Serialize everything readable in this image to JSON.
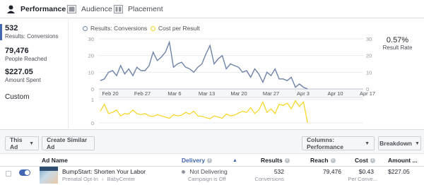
{
  "tabs": [
    {
      "label": "Performance",
      "icon": "person-icon",
      "active": true
    },
    {
      "label": "Audience",
      "icon": "audience-icon",
      "active": false
    },
    {
      "label": "Placement",
      "icon": "placement-icon",
      "active": false
    }
  ],
  "metrics": {
    "results": {
      "value": "532",
      "label": "Results: Conversions"
    },
    "reach": {
      "value": "79,476",
      "label": "People Reached"
    },
    "spent": {
      "value": "$227.05",
      "label": "Amount Spent"
    },
    "custom": "Custom"
  },
  "result_rate": {
    "value": "0.57%",
    "label": "Result Rate"
  },
  "colors": {
    "accent": "#4267b2",
    "conversions": "#6f83a9",
    "cost": "#f7d51d"
  },
  "chart_data": [
    {
      "type": "line",
      "legend": [
        "Results: Conversions",
        "Cost per Result"
      ],
      "x_ticks": [
        "Feb 20",
        "Feb 27",
        "Mar 6",
        "Mar 13",
        "Mar 20",
        "Mar 27",
        "Apr 3",
        "Apr 10",
        "Apr 17"
      ],
      "ylim": [
        0,
        30
      ],
      "y_ticks": [
        "0",
        "10",
        "20",
        "30"
      ],
      "grid": true,
      "series": [
        {
          "name": "Results: Conversions",
          "values": [
            5,
            6,
            10,
            11,
            8,
            14,
            9,
            12,
            8,
            13,
            11,
            11,
            14,
            22,
            17,
            19,
            22,
            28,
            13,
            15,
            16,
            13,
            12,
            10,
            13,
            15,
            21,
            26,
            15,
            18,
            20,
            12,
            15,
            14,
            13,
            10,
            11,
            7,
            12,
            9,
            4,
            10,
            8,
            12,
            6,
            6,
            5,
            7,
            1,
            3,
            1,
            0
          ]
        }
      ]
    },
    {
      "type": "line",
      "ylim": [
        0,
        1
      ],
      "y_ticks": [
        "0",
        "1"
      ],
      "series": [
        {
          "name": "Cost per Result",
          "values": [
            0.5,
            0.8,
            0.4,
            0.45,
            0.55,
            0.3,
            0.4,
            0.38,
            0.55,
            0.4,
            0.35,
            0.4,
            0.3,
            0.28,
            0.35,
            0.3,
            0.25,
            0.2,
            0.35,
            0.3,
            0.33,
            0.45,
            0.38,
            0.5,
            0.3,
            0.28,
            0.22,
            0.18,
            0.3,
            0.25,
            0.2,
            0.38,
            0.3,
            0.33,
            0.42,
            0.5,
            0.45,
            0.65,
            0.4,
            0.55,
            0.9,
            0.45,
            0.6,
            0.4,
            0.8,
            0.75,
            0.85,
            0.6,
            0.95,
            0.7,
            0.9,
            0
          ]
        }
      ]
    }
  ],
  "toolbar": {
    "this_ad": "This Ad",
    "create_similar": "Create Similar Ad",
    "columns": "Columns: Performance",
    "breakdown": "Breakdown"
  },
  "table": {
    "headers": {
      "ad_name": "Ad Name",
      "delivery": "Delivery",
      "results": "Results",
      "reach": "Reach",
      "cost": "Cost",
      "amount": "Amount ..."
    },
    "row": {
      "name": "BumpStart: Shorten Your Labor",
      "sub1": "Prenatal Opt-In",
      "sub2": "BabyCenter",
      "delivery": "Not Delivering",
      "delivery_sub": "Campaign is Off",
      "results": "532",
      "results_sub": "Conversions",
      "reach": "79,476",
      "cost": "$0.43",
      "cost_sub": "Per Conve...",
      "amount": "$227.05"
    }
  }
}
